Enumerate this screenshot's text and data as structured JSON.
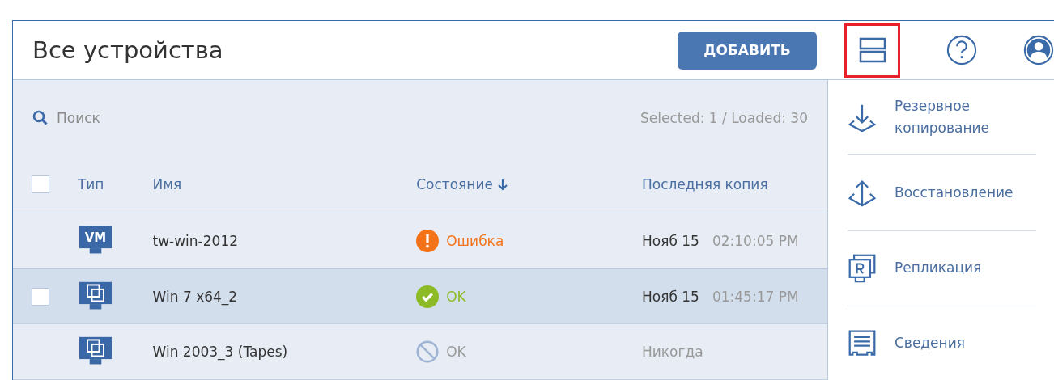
{
  "header": {
    "title": "Все устройства",
    "add_button": "ДОБАВИТЬ",
    "layout_toggle_highlighted": true
  },
  "search": {
    "placeholder": "Поиск"
  },
  "selection_info": "Selected: 1 / Loaded: 30",
  "table": {
    "select_all_checked": false,
    "columns": [
      {
        "label": "Тип",
        "sorted": false
      },
      {
        "label": "Имя",
        "sorted": false
      },
      {
        "label": "Состояние",
        "sorted": true
      },
      {
        "label": "Последняя копия",
        "sorted": false
      }
    ],
    "rows": [
      {
        "kind": "vm",
        "type_label": "VM",
        "name": "tw-win-2012",
        "status": {
          "kind": "error",
          "label": "Ошибка"
        },
        "last_backup": {
          "kind": "date",
          "date": "Нояб 15",
          "time": "02:10:05 PM"
        },
        "selected": false
      },
      {
        "kind": "machine",
        "name": "Win 7 x64_2",
        "status": {
          "kind": "ok",
          "label": "OK"
        },
        "last_backup": {
          "kind": "date",
          "date": "Нояб 15",
          "time": "01:45:17 PM"
        },
        "selected": true,
        "checked": false
      },
      {
        "kind": "machine",
        "name": "Win 2003_3 (Tapes)",
        "status": {
          "kind": "disabled",
          "label": "OK"
        },
        "last_backup": {
          "kind": "never",
          "text": "Никогда"
        },
        "selected": false
      }
    ]
  },
  "actions": [
    {
      "kind": "backup",
      "label": "Резервное копирование"
    },
    {
      "kind": "recovery",
      "label": "Восстановление"
    },
    {
      "kind": "replication",
      "label": "Репликация"
    },
    {
      "kind": "details",
      "label": "Сведения"
    }
  ]
}
